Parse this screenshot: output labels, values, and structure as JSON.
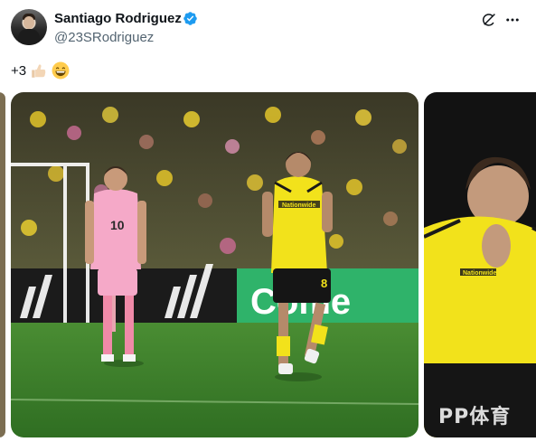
{
  "post": {
    "author_name": "Santiago Rodriguez",
    "author_handle": "@23SRodriguez",
    "text": "+3",
    "emojis": [
      "thumbs-up-emoji",
      "grinning-face-emoji"
    ]
  },
  "icons": {
    "verified": "verified-badge-icon",
    "grok": "grok-icon",
    "more": "more-icon"
  },
  "media": {
    "main_photo": {
      "sponsor_board": "Come",
      "player_shirt_number": "8",
      "jersey_sponsor": "Nationwide",
      "opponent_shirt_number": "10"
    },
    "right_photo": {
      "jersey_sponsor": "Nationwide"
    },
    "watermark": "PP体育"
  },
  "colors": {
    "verified_blue": "#1d9bf0",
    "handle_gray": "#536471",
    "crew_yellow": "#f2e21b",
    "miami_pink": "#f5a9c8",
    "pitch_green": "#3f8a2e",
    "ad_board_green": "#2fb36a"
  }
}
